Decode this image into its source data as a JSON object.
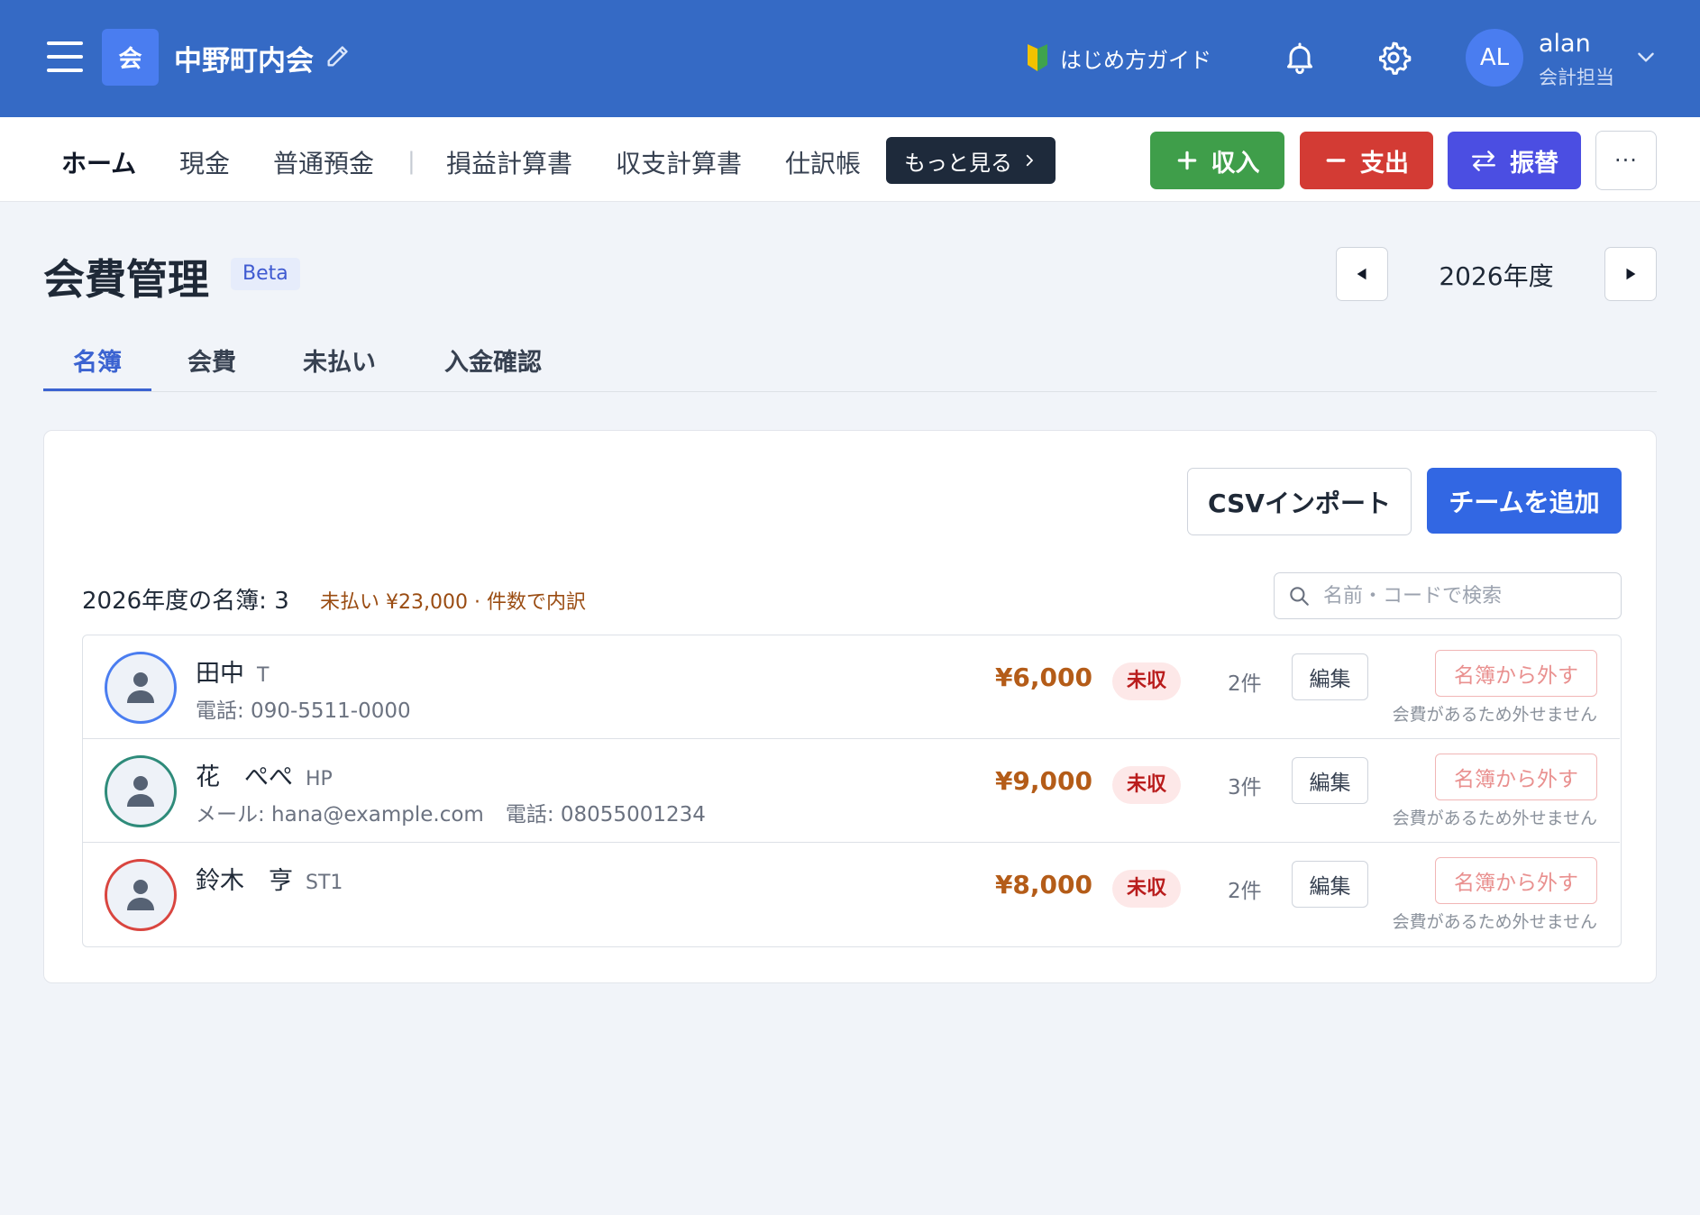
{
  "header": {
    "org_initial": "会",
    "org_name": "中野町内会",
    "guide_label": "はじめ方ガイド",
    "user_initials": "AL",
    "user_name": "alan",
    "user_role": "会計担当",
    "icons": [
      "menu-icon",
      "pencil-icon",
      "beginner-leaf-icon",
      "bell-icon",
      "gear-icon",
      "chevron-down-icon"
    ]
  },
  "nav": {
    "items": [
      "ホーム",
      "現金",
      "普通預金",
      "損益計算書",
      "収支計算書",
      "仕訳帳"
    ],
    "separator": "|",
    "more_label": "もっと見る",
    "income_label": "収入",
    "expense_label": "支出",
    "transfer_label": "振替",
    "dots_label": "···"
  },
  "page": {
    "title": "会費管理",
    "beta": "Beta",
    "year": "2026年度"
  },
  "tabs": [
    "名簿",
    "会費",
    "未払い",
    "入金確認"
  ],
  "actions": {
    "csv_import": "CSVインポート",
    "add_team": "チームを追加"
  },
  "summary": {
    "text": "2026年度の名簿: 3",
    "unpaid": "未払い ¥23,000 · 件数で内訳"
  },
  "search": {
    "placeholder": "名前・コードで検索",
    "value": ""
  },
  "members": [
    {
      "name": "田中",
      "code": "T",
      "contact": [
        "電話: 090-5511-0000"
      ],
      "amount": "¥6,000",
      "status": "未収",
      "count": "2件",
      "edit": "編集",
      "remove": "名簿から外す",
      "note": "会費があるため外せません",
      "ring_color": "#4a7df0"
    },
    {
      "name": "花　ぺぺ",
      "code": "HP",
      "contact": [
        "メール: hana@example.com",
        "電話: 08055001234"
      ],
      "amount": "¥9,000",
      "status": "未収",
      "count": "3件",
      "edit": "編集",
      "remove": "名簿から外す",
      "note": "会費があるため外せません",
      "ring_color": "#2e8b7a"
    },
    {
      "name": "鈴木　亨",
      "code": "ST1",
      "contact": [],
      "amount": "¥8,000",
      "status": "未収",
      "count": "2件",
      "edit": "編集",
      "remove": "名簿から外す",
      "note": "会費があるため外せません",
      "ring_color": "#d9453f"
    }
  ],
  "colors": {
    "header_bg": "#356ac5",
    "accent": "#3b63d1",
    "income": "#3f9e4a",
    "expense": "#d33b34",
    "transfer": "#4b4ee2",
    "unpaid_amount": "#b45c18"
  }
}
